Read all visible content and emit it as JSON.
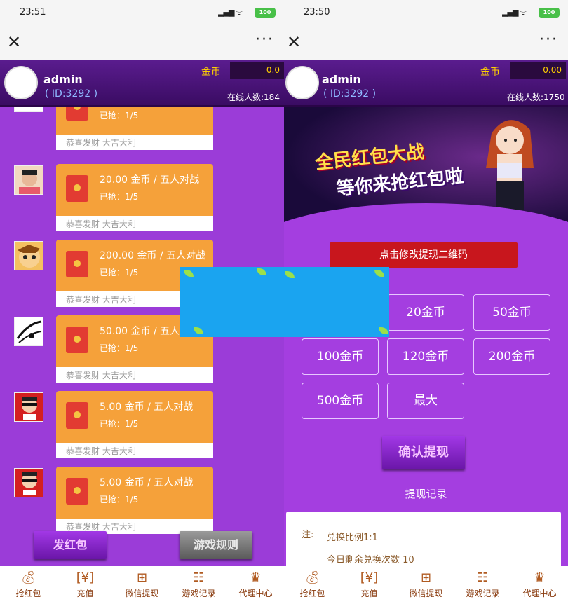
{
  "left_screen": {
    "status": {
      "time": "23:51",
      "battery": "100"
    },
    "user": {
      "name": "admin",
      "id": "( ID:3292 )"
    },
    "coin_label": "金币",
    "coin_value": "0.0",
    "online": "在线人数:184",
    "messages": [
      {
        "amount": "",
        "grabbed": "已抢：1/5",
        "wish": "恭喜发财 大吉大利"
      },
      {
        "amount": "20.00 金币 / 五人对战",
        "grabbed": "已抢：1/5",
        "wish": "恭喜发财 大吉大利"
      },
      {
        "amount": "200.00 金币 / 五人对战",
        "grabbed": "已抢：1/5",
        "wish": "恭喜发财 大吉大利"
      },
      {
        "amount": "50.00 金币 / 五人",
        "grabbed": "已抢：1/5",
        "wish": "恭喜发财 大吉大利"
      },
      {
        "amount": "5.00 金币 / 五人对战",
        "grabbed": "已抢：1/5",
        "wish": "恭喜发财 大吉大利"
      },
      {
        "amount": "5.00 金币 / 五人对战",
        "grabbed": "已抢：1/5",
        "wish": "恭喜发财 大吉大利"
      }
    ],
    "send_btn": "发红包",
    "rules_btn": "游戏规则"
  },
  "right_screen": {
    "status": {
      "time": "23:50",
      "battery": "100"
    },
    "user": {
      "name": "admin",
      "id": "( ID:3292 )"
    },
    "coin_label": "金币",
    "coin_value": "0.00",
    "online": "在线人数:1750",
    "banner": {
      "line1": "全民红包大战",
      "line2": "等你来抢红包啦"
    },
    "qr_button": "点击修改提现二维码",
    "amounts": [
      "20金币",
      "50金币",
      "100金币",
      "120金币",
      "200金币",
      "500金币",
      "最大"
    ],
    "confirm": "确认提现",
    "record_title": "提现记录",
    "note": {
      "label": "注:",
      "ratio": "兑换比例1:1",
      "remaining": "今日剩余兑换次数 10"
    }
  },
  "nav": [
    {
      "icon": "money-bag-icon",
      "label": "抢红包"
    },
    {
      "icon": "yen-ticket-icon",
      "label": "充值"
    },
    {
      "icon": "gift-icon",
      "label": "微信提现"
    },
    {
      "icon": "list-icon",
      "label": "游戏记录"
    },
    {
      "icon": "crown-icon",
      "label": "代理中心"
    }
  ],
  "colors": {
    "feed_bg": "#9b3cd8",
    "card": "#f5a13a",
    "header": "#4a1478",
    "qr_btn": "#c8161d",
    "overlay": "#1aa4f0"
  }
}
